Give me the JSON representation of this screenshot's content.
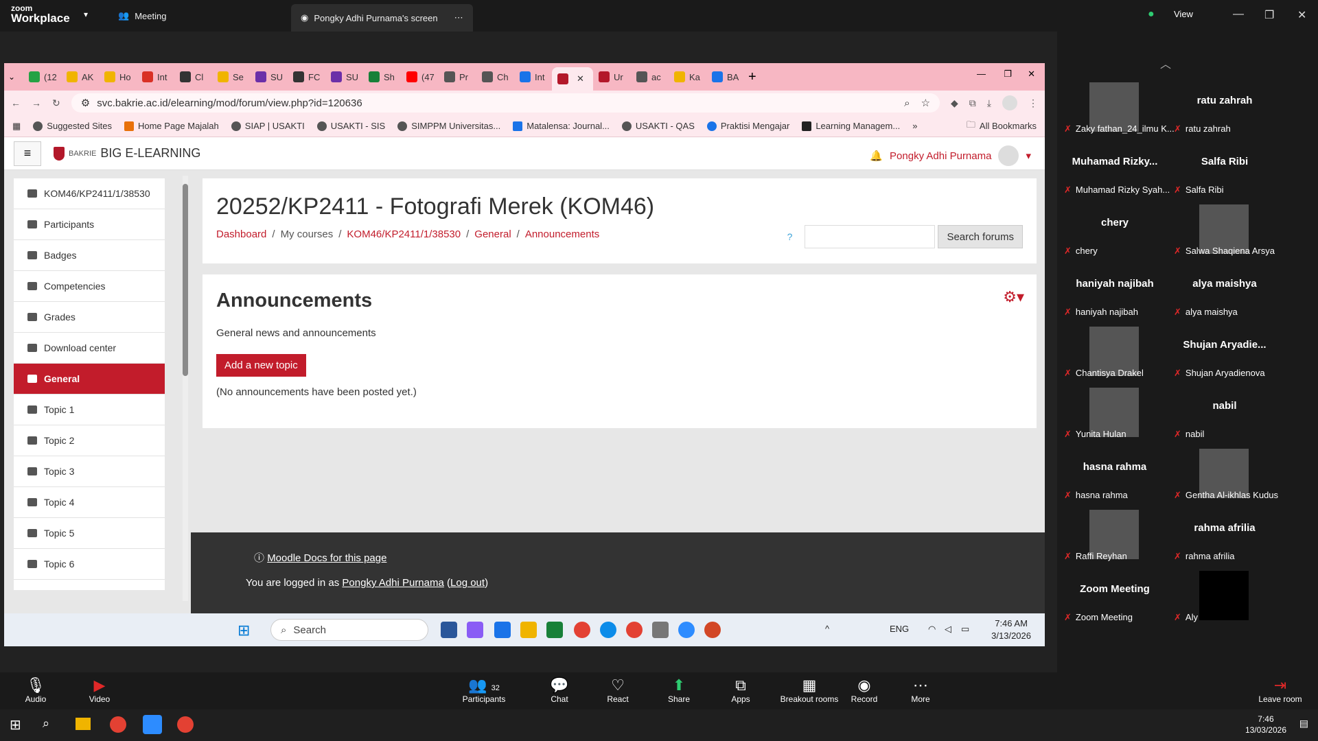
{
  "zoom": {
    "brand_small": "zoom",
    "brand": "Workplace",
    "meeting_tab": "Meeting",
    "screen_tab": "Pongky Adhi Purnama's screen",
    "view_label": "View"
  },
  "browser": {
    "tabs": [
      "(12",
      "AK",
      "Ho",
      "Int",
      "Cl",
      "Se",
      "SU",
      "FC",
      "SU",
      "Sh",
      "(47",
      "Pr",
      "Ch",
      "Int",
      "",
      "Ur",
      "ac",
      "Ka",
      "BA"
    ],
    "url": "svc.bakrie.ac.id/elearning/mod/forum/view.php?id=120636",
    "bookmarks": [
      "Suggested Sites",
      "Home Page Majalah",
      "SIAP | USAKTI",
      "USAKTI - SIS",
      "SIMPPM Universitas...",
      "Matalensa: Journal...",
      "USAKTI - QAS",
      "Praktisi Mengajar",
      "Learning Managem..."
    ],
    "all_bookmarks": "All Bookmarks"
  },
  "moodle": {
    "logo_small": "BAKRIE",
    "site_name": "BIG E-LEARNING",
    "user_name": "Pongky Adhi Purnama",
    "sidebar": [
      {
        "label": "KOM46/KP2411/1/38530"
      },
      {
        "label": "Participants"
      },
      {
        "label": "Badges"
      },
      {
        "label": "Competencies"
      },
      {
        "label": "Grades"
      },
      {
        "label": "Download center"
      },
      {
        "label": "General"
      },
      {
        "label": "Topic 1"
      },
      {
        "label": "Topic 2"
      },
      {
        "label": "Topic 3"
      },
      {
        "label": "Topic 4"
      },
      {
        "label": "Topic 5"
      },
      {
        "label": "Topic 6"
      }
    ],
    "page_title": "20252/KP2411 - Fotografi Merek (KOM46)",
    "breadcrumb": [
      "Dashboard",
      "My courses",
      "KOM46/KP2411/1/38530",
      "General",
      "Announcements"
    ],
    "search_button": "Search forums",
    "forum_title": "Announcements",
    "forum_intro": "General news and announcements",
    "add_topic": "Add a new topic",
    "no_posts": "(No announcements have been posted yet.)",
    "footer_docs": "Moodle Docs for this page",
    "footer_logged_prefix": "You are logged in as",
    "footer_user": "Pongky Adhi Purnama",
    "footer_logout": "Log out"
  },
  "shared_taskbar": {
    "search_placeholder": "Search",
    "lang": "ENG",
    "time": "7:46 AM",
    "date": "3/13/2026"
  },
  "participants": [
    {
      "name": "",
      "label": "Zaky fathan_24_ilmu K..."
    },
    {
      "name": "ratu zahrah",
      "label": "ratu zahrah"
    },
    {
      "name": "Muhamad  Rizky...",
      "label": "Muhamad Rizky Syah..."
    },
    {
      "name": "Salfa Ribi",
      "label": "Salfa Ribi"
    },
    {
      "name": "chery",
      "label": "chery"
    },
    {
      "name": "",
      "label": "Salwa Shaqiena Arsya"
    },
    {
      "name": "haniyah najibah",
      "label": "haniyah najibah"
    },
    {
      "name": "alya maishya",
      "label": "alya maishya"
    },
    {
      "name": "",
      "label": "Chantisya Drakel"
    },
    {
      "name": "Shujan  Aryadie...",
      "label": "Shujan Aryadienova"
    },
    {
      "name": "",
      "label": "Yunita Hulan"
    },
    {
      "name": "nabil",
      "label": "nabil"
    },
    {
      "name": "hasna rahma",
      "label": "hasna rahma"
    },
    {
      "name": "",
      "label": "Gentha Al-ikhlas Kudus"
    },
    {
      "name": "",
      "label": "Raffi Reyhan"
    },
    {
      "name": "rahma afrilia",
      "label": "rahma afrilia"
    },
    {
      "name": "Zoom Meeting",
      "label": "Zoom Meeting"
    },
    {
      "name": "",
      "label": "Aly"
    }
  ],
  "zoom_controls": {
    "audio": "Audio",
    "video": "Video",
    "participants": "Participants",
    "participants_count": "32",
    "chat": "Chat",
    "react": "React",
    "share": "Share",
    "apps": "Apps",
    "breakout": "Breakout rooms",
    "record": "Record",
    "more": "More",
    "leave": "Leave room"
  },
  "os": {
    "time": "7:46",
    "date": "13/03/2026"
  }
}
